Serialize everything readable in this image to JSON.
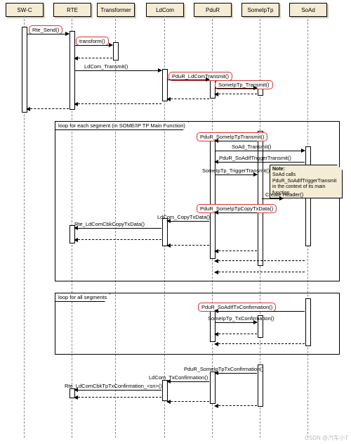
{
  "lifelines": [
    "SW-C",
    "RTE",
    "Transformer",
    "LdCom",
    "PduR",
    "SomeIpTp",
    "SoAd"
  ],
  "top": [
    {
      "k": "rtesend",
      "t": "Rte_Send()"
    },
    {
      "k": "transform",
      "t": "transform()"
    },
    {
      "k": "ldcomtx",
      "t": "LdCom_Transmit()"
    },
    {
      "k": "pdurldcomtx",
      "t": "PduR_LdComTransmit()"
    },
    {
      "k": "siptx",
      "t": "SomeIpTp_Transmit()"
    }
  ],
  "loop1": {
    "title": "loop for each segment (in SOME/IP TP Main Function)",
    "m": {
      "pdursiptx": "PduR_SomeIpTpTransmit()",
      "soadtx": "SoAd_Transmit()",
      "pdurtrig": "PduR_SoAdIfTriggerTransmit()",
      "siptrig": "SomeIpTp_TriggerTransmit()",
      "create": "Create Header()",
      "pdurcopy": "PduR_SomeIpTpCopyTxData()",
      "ldcomcopy": "LdCom_CopyTxData()",
      "rtecopy": "Rte_LdComCbkCopyTxData()"
    }
  },
  "note": {
    "h": "Note:",
    "b": "SoAd calls PduR_SoAdIfTriggerTransmit in the context of its main function"
  },
  "loop2": {
    "title": "loop for all segments",
    "pdurconf": "PduR_SoAdIfTxConfirmation()",
    "sipconf": "SomeIpTp_TxConfirmation()"
  },
  "bottom": {
    "pdursipconf": "PduR_SomeIpTpTxConfirmation()",
    "ldcomconf": "LdCom_TxConfirmation()",
    "rteconf": "Rte_LdComCbkTpTxConfirmation_<sn>()"
  },
  "watermark": "CSDN @汽车小T"
}
